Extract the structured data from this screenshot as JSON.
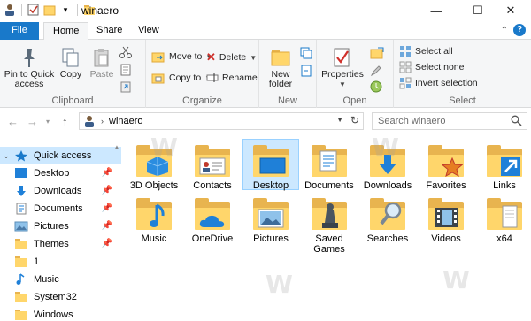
{
  "window": {
    "title": "winaero",
    "minimize_glyph": "—",
    "maximize_glyph": "☐",
    "close_glyph": "✕"
  },
  "tabs": {
    "file": "File",
    "home": "Home",
    "share": "Share",
    "view": "View",
    "help": "?"
  },
  "ribbon": {
    "clipboard": {
      "label": "Clipboard",
      "pin_to_quick_access": "Pin to Quick access",
      "copy": "Copy",
      "paste": "Paste"
    },
    "organize": {
      "label": "Organize",
      "move_to": "Move to",
      "copy_to": "Copy to",
      "delete": "Delete",
      "rename": "Rename"
    },
    "new": {
      "label": "New",
      "new_folder": "New folder"
    },
    "open": {
      "label": "Open",
      "properties": "Properties"
    },
    "select": {
      "label": "Select",
      "select_all": "Select all",
      "select_none": "Select none",
      "invert_selection": "Invert selection"
    }
  },
  "address": {
    "path": "winaero",
    "search_placeholder": "Search winaero"
  },
  "nav_pane": {
    "items": [
      {
        "label": "Quick access",
        "icon": "star-icon",
        "pinned": false
      },
      {
        "label": "Desktop",
        "icon": "desktop-icon",
        "pinned": true
      },
      {
        "label": "Downloads",
        "icon": "download-icon",
        "pinned": true
      },
      {
        "label": "Documents",
        "icon": "documents-icon",
        "pinned": true
      },
      {
        "label": "Pictures",
        "icon": "pictures-icon",
        "pinned": true
      },
      {
        "label": "Themes",
        "icon": "folder-icon",
        "pinned": true
      },
      {
        "label": "1",
        "icon": "folder-icon",
        "pinned": false
      },
      {
        "label": "Music",
        "icon": "music-icon",
        "pinned": false
      },
      {
        "label": "System32",
        "icon": "folder-icon",
        "pinned": false
      },
      {
        "label": "Windows",
        "icon": "folder-icon",
        "pinned": false
      }
    ]
  },
  "files": [
    {
      "label": "3D Objects",
      "icon": "3d-objects-folder-icon",
      "selected": false
    },
    {
      "label": "Contacts",
      "icon": "contacts-folder-icon",
      "selected": false
    },
    {
      "label": "Desktop",
      "icon": "desktop-folder-icon",
      "selected": true
    },
    {
      "label": "Documents",
      "icon": "documents-folder-icon",
      "selected": false
    },
    {
      "label": "Downloads",
      "icon": "downloads-folder-icon",
      "selected": false
    },
    {
      "label": "Favorites",
      "icon": "favorites-folder-icon",
      "selected": false
    },
    {
      "label": "Links",
      "icon": "links-folder-icon",
      "selected": false
    },
    {
      "label": "Music",
      "icon": "music-folder-icon",
      "selected": false
    },
    {
      "label": "OneDrive",
      "icon": "onedrive-folder-icon",
      "selected": false
    },
    {
      "label": "Pictures",
      "icon": "pictures-folder-icon",
      "selected": false
    },
    {
      "label": "Saved Games",
      "icon": "saved-games-folder-icon",
      "selected": false
    },
    {
      "label": "Searches",
      "icon": "searches-folder-icon",
      "selected": false
    },
    {
      "label": "Videos",
      "icon": "videos-folder-icon",
      "selected": false
    },
    {
      "label": "x64",
      "icon": "folder-icon",
      "selected": false
    }
  ],
  "colors": {
    "accent": "#1979ca",
    "selection": "#cce8ff",
    "folder_back": "#e8b44f",
    "folder_front": "#ffd66b"
  }
}
